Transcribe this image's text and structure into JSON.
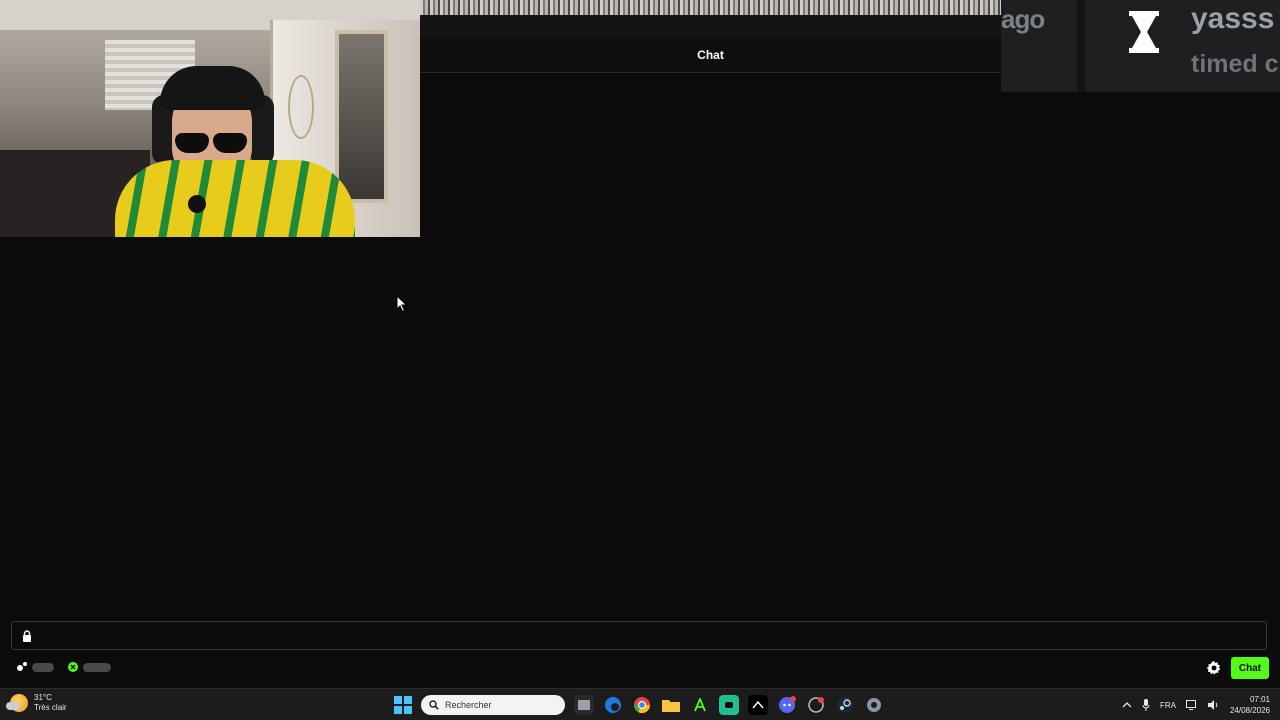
{
  "webcam": {
    "description_free": true
  },
  "chat": {
    "header_title": "Chat",
    "input_value": "",
    "input_placeholder": "",
    "send_button_label": "Chat"
  },
  "notification": {
    "ago_fragment": "ago",
    "user_fragment": "yasss",
    "status_fragment": "timed c"
  },
  "taskbar": {
    "weather_temp": "31°C",
    "weather_desc": "Très clair",
    "search_placeholder": "Rechercher",
    "language": "FRA",
    "time": "07:01",
    "date": "24/08/2026",
    "icons": [
      "windows-icon",
      "search-icon",
      "file-explorer-window-icon",
      "edge-icon",
      "chrome-icon",
      "folder-icon",
      "app-a-icon",
      "app-green-icon",
      "app-dark-icon",
      "discord-icon",
      "app-red-icon",
      "steam-icon",
      "settings-icon"
    ]
  },
  "colors": {
    "accent": "#53fc18",
    "background": "#0b0b0c"
  }
}
